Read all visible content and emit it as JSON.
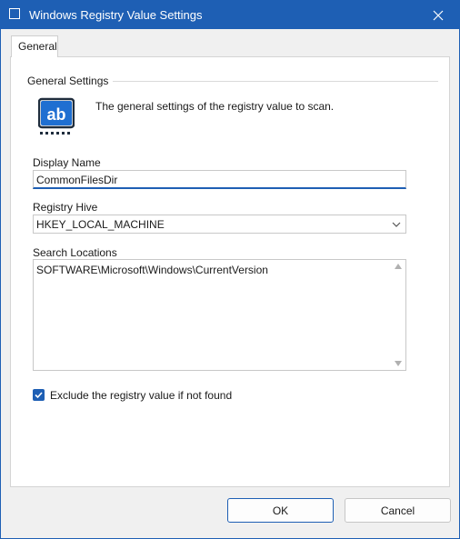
{
  "window": {
    "title": "Windows Registry Value Settings",
    "accent_color": "#1e5fb4",
    "close_icon": "close-icon"
  },
  "tabs": [
    {
      "label": "General",
      "selected": true
    }
  ],
  "general": {
    "group_title": "General Settings",
    "icon": "text-field-ab-icon",
    "description": "The general settings of the registry value to scan.",
    "display_name": {
      "label": "Display Name",
      "value": "CommonFilesDir"
    },
    "registry_hive": {
      "label": "Registry Hive",
      "selected": "HKEY_LOCAL_MACHINE"
    },
    "search_locations": {
      "label": "Search Locations",
      "value": "SOFTWARE\\Microsoft\\Windows\\CurrentVersion"
    },
    "exclude_if_not_found": {
      "label": "Exclude the registry value if not found",
      "checked": true
    }
  },
  "buttons": {
    "ok": "OK",
    "cancel": "Cancel"
  }
}
